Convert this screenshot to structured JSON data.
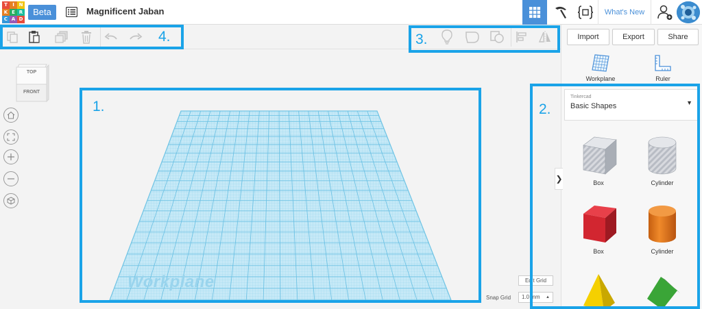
{
  "app": {
    "logo_letters": [
      "T",
      "I",
      "N",
      "K",
      "E",
      "R",
      "C",
      "A",
      "D"
    ],
    "logo_colors": [
      "#e74c3c",
      "#e67e22",
      "#f1c40f",
      "#e67e22",
      "#27ae60",
      "#1abc9c",
      "#3498db",
      "#9b59b6",
      "#e74c3c"
    ],
    "beta_label": "Beta",
    "design_title": "Magnificent Jaban",
    "whats_new": "What's New"
  },
  "callouts": {
    "workplane": "1.",
    "shapes_panel": "2.",
    "shape_tools": "3.",
    "edit_tools": "4."
  },
  "panel": {
    "import_label": "Import",
    "export_label": "Export",
    "share_label": "Share",
    "workplane_label": "Workplane",
    "ruler_label": "Ruler",
    "library_source": "Tinkercad",
    "library_name": "Basic Shapes",
    "shapes": [
      {
        "label": "Box",
        "style": "striped"
      },
      {
        "label": "Cylinder",
        "style": "striped"
      },
      {
        "label": "Box",
        "color": "#d22630"
      },
      {
        "label": "Cylinder",
        "color": "#e8761c"
      },
      {
        "label": "",
        "color": "#f5d000"
      },
      {
        "label": "",
        "color": "#3aa537"
      }
    ]
  },
  "viewcube": {
    "top": "TOP",
    "front": "FRONT"
  },
  "canvas": {
    "workplane_watermark": "Workplane",
    "edit_grid_label": "Edit Grid",
    "snap_grid_label": "Snap Grid",
    "snap_grid_value": "1.0 mm"
  },
  "colors": {
    "accent": "#4a90d9",
    "callout": "#1aa3e8",
    "grid_fill": "#bde5f4",
    "grid_line": "#7fcbe8"
  }
}
